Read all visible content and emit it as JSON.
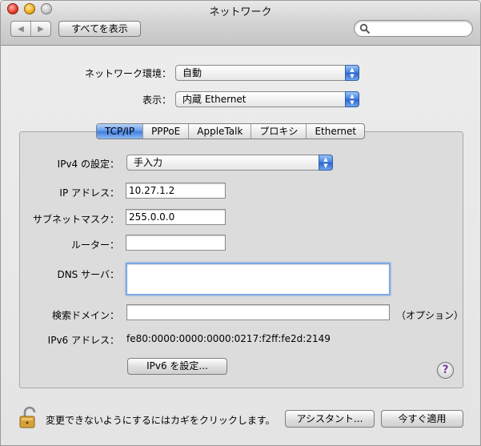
{
  "window": {
    "title": "ネットワーク"
  },
  "toolbar": {
    "back_glyph": "◀",
    "forward_glyph": "▶",
    "show_all_label": "すべてを表示",
    "search_placeholder": "",
    "search_icon": "magnifier-icon"
  },
  "location": {
    "label": "ネットワーク環境：",
    "value": "自動"
  },
  "show": {
    "label": "表示：",
    "value": "内蔵 Ethernet"
  },
  "tabs": [
    {
      "label": "TCP/IP",
      "active": true
    },
    {
      "label": "PPPoE",
      "active": false
    },
    {
      "label": "AppleTalk",
      "active": false
    },
    {
      "label": "プロキシ",
      "active": false
    },
    {
      "label": "Ethernet",
      "active": false
    }
  ],
  "tcpip": {
    "ipv4_config": {
      "label": "IPv4 の設定：",
      "value": "手入力"
    },
    "ip_address": {
      "label": "IP アドレス：",
      "value": "10.27.1.2"
    },
    "subnet_mask": {
      "label": "サブネットマスク：",
      "value": "255.0.0.0"
    },
    "router": {
      "label": "ルーター：",
      "value": ""
    },
    "dns": {
      "label": "DNS サーバ：",
      "value": ""
    },
    "search_domains": {
      "label": "検索ドメイン：",
      "value": "",
      "hint": "（オプション）"
    },
    "ipv6_address": {
      "label": "IPv6 アドレス：",
      "value": "fe80:0000:0000:0000:0217:f2ff:fe2d:2149"
    },
    "configure_ipv6_label": "IPv6 を設定..."
  },
  "help_glyph": "?",
  "footer": {
    "lock_text": "変更できないようにするにはカギをクリックします。",
    "assistant_label": "アシスタント...",
    "apply_label": "今すぐ適用"
  },
  "colors": {
    "accent_blue": "#3f7ddd",
    "focus_ring": "#7fa8e4",
    "help_purple": "#7b3fa6"
  }
}
